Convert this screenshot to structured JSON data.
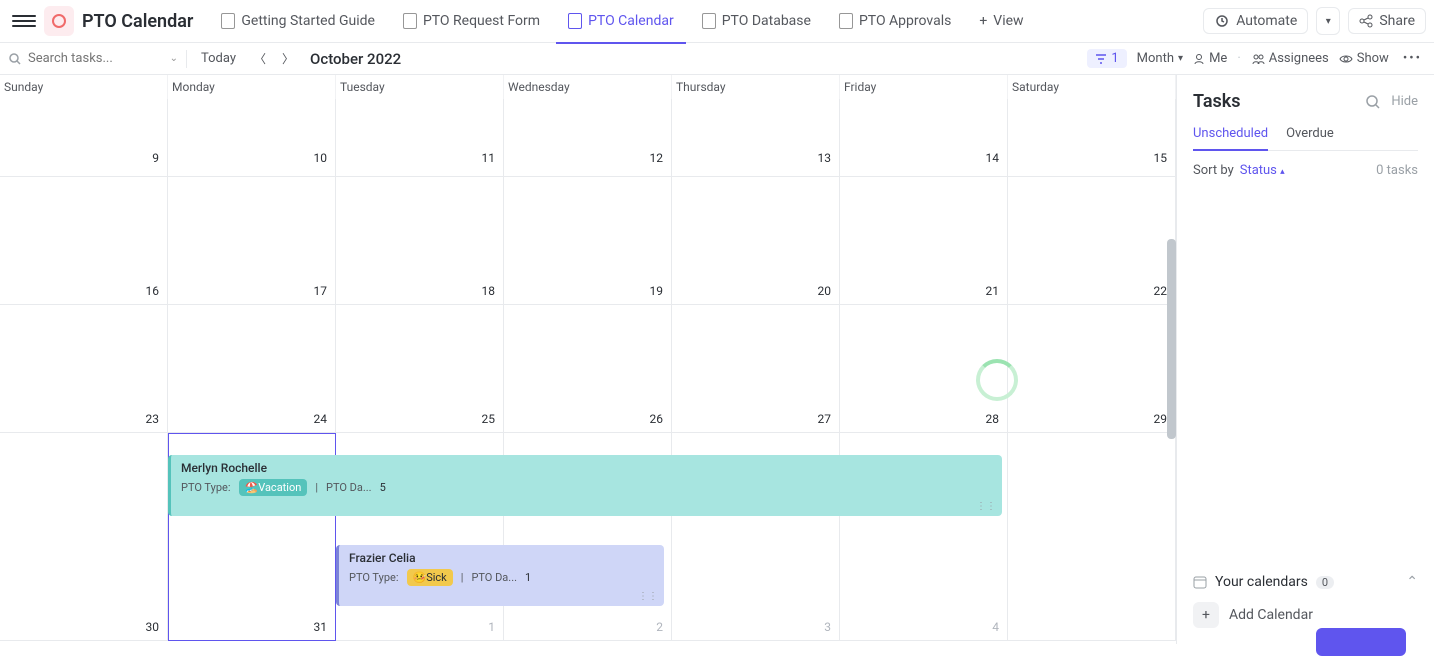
{
  "header": {
    "app_title": "PTO Calendar",
    "tabs": [
      {
        "label": "Getting Started Guide"
      },
      {
        "label": "PTO Request Form"
      },
      {
        "label": "PTO Calendar",
        "active": true
      },
      {
        "label": "PTO Database"
      },
      {
        "label": "PTO Approvals"
      }
    ],
    "view_label": "View",
    "automate_label": "Automate",
    "share_label": "Share"
  },
  "toolbar": {
    "search_placeholder": "Search tasks...",
    "today_label": "Today",
    "month_title": "October 2022",
    "filter_count": "1",
    "period_label": "Month",
    "me_label": "Me",
    "assignees_label": "Assignees",
    "show_label": "Show"
  },
  "calendar": {
    "day_headers": [
      "Sunday",
      "Monday",
      "Tuesday",
      "Wednesday",
      "Thursday",
      "Friday",
      "Saturday"
    ],
    "weeks": [
      [
        "",
        "9",
        "10",
        "11",
        "12",
        "13",
        "14",
        "15"
      ],
      [
        "16",
        "17",
        "18",
        "19",
        "20",
        "21",
        "22"
      ],
      [
        "23",
        "24",
        "25",
        "26",
        "27",
        "28",
        "29"
      ],
      [
        "30",
        "31",
        "1",
        "2",
        "3",
        "4",
        ""
      ]
    ],
    "events": [
      {
        "title": "Merlyn Rochelle",
        "type_label": "PTO Type:",
        "badge": "🏖️Vacation",
        "badge_bg": "#55c3bb",
        "extra_key": "PTO Da...",
        "extra_val": "5"
      },
      {
        "title": "Frazier Celia",
        "type_label": "PTO Type:",
        "badge": "🤒Sick",
        "badge_bg": "#f2c94c",
        "extra_key": "PTO Da...",
        "extra_val": "1"
      }
    ]
  },
  "sidebar": {
    "title": "Tasks",
    "hide_label": "Hide",
    "tabs": [
      {
        "label": "Unscheduled",
        "active": true
      },
      {
        "label": "Overdue"
      }
    ],
    "sort_label": "Sort by",
    "sort_value": "Status",
    "count_label": "0 tasks",
    "your_calendars_label": "Your calendars",
    "your_calendars_count": "0",
    "add_calendar_label": "Add Calendar"
  }
}
